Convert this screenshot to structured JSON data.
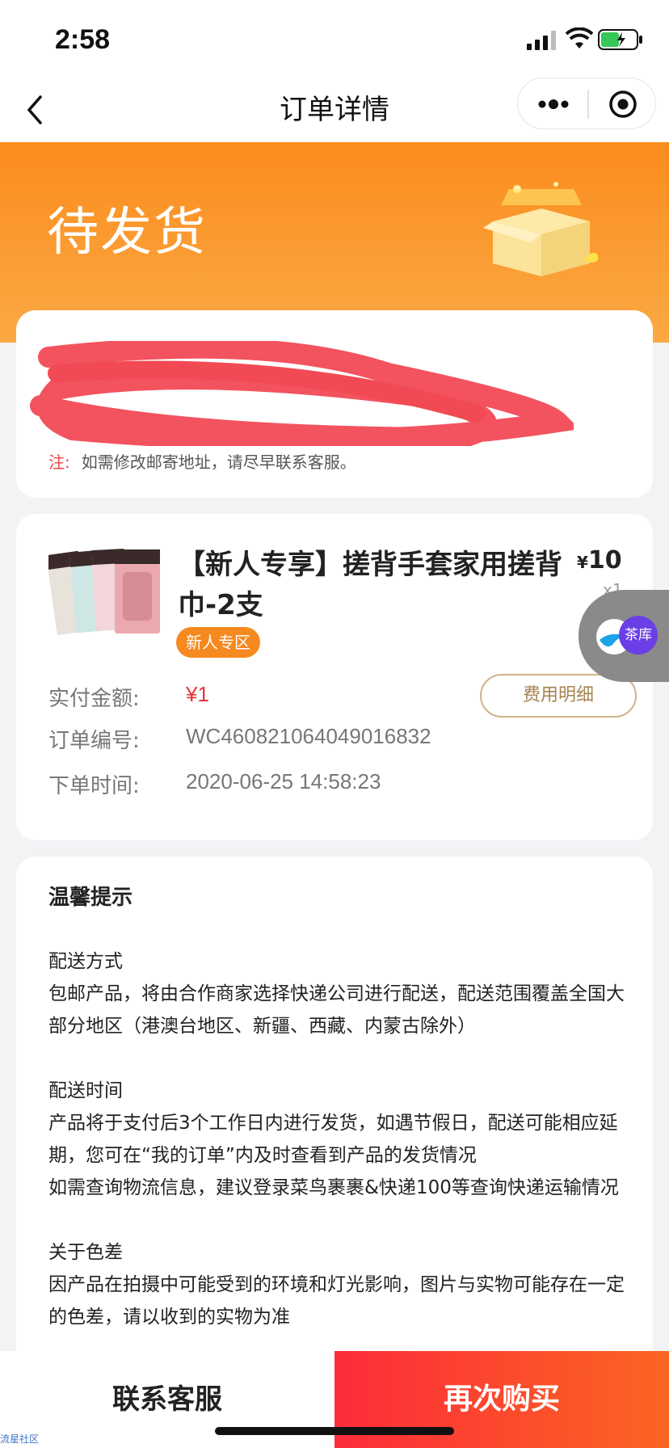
{
  "status_bar": {
    "time": "2:58"
  },
  "nav": {
    "title": "订单详情"
  },
  "banner": {
    "status": "待发货"
  },
  "address": {
    "note_prefix": "注:",
    "note": "如需修改邮寄地址，请尽早联系客服。"
  },
  "product": {
    "title": "【新人专享】搓背手套家用搓背巾-2支",
    "price_symbol": "¥",
    "price": "10",
    "quantity": "x1",
    "badge": "新人专区"
  },
  "order_info": {
    "paid_label": "实付金额:",
    "paid_value": "¥1",
    "fee_button": "费用明细",
    "order_no_label": "订单编号:",
    "order_no_value": "WC460821064049016832",
    "time_label": "下单时间:",
    "time_value": "2020-06-25 14:58:23"
  },
  "float_widget": {
    "label": "茶库"
  },
  "tips": {
    "title": "温馨提示",
    "sections": [
      {
        "heading": "配送方式",
        "lines": [
          "包邮产品，将由合作商家选择快递公司进行配送，配送范围覆盖全国大部分地区（港澳台地区、新疆、西藏、内蒙古除外）"
        ]
      },
      {
        "heading": "配送时间",
        "lines": [
          "产品将于支付后3个工作日内进行发货，如遇节假日，配送可能相应延期，您可在“我的订单”内及时查看到产品的发货情况",
          "如需查询物流信息，建议登录菜鸟裹裹&快递100等查询快递运输情况"
        ]
      },
      {
        "heading": "关于色差",
        "lines": [
          "因产品在拍摄中可能受到的环境和灯光影响，图片与实物可能存在一定的色差，请以收到的实物为准"
        ]
      }
    ]
  },
  "bottom": {
    "contact": "联系客服",
    "buy_again": "再次购买"
  },
  "watermark": "流星社区",
  "colors": {
    "accent_orange": "#fb8c1d",
    "price_red": "#e8323c",
    "buy_gradient_start": "#fc2c3a",
    "buy_gradient_end": "#fb6521"
  }
}
